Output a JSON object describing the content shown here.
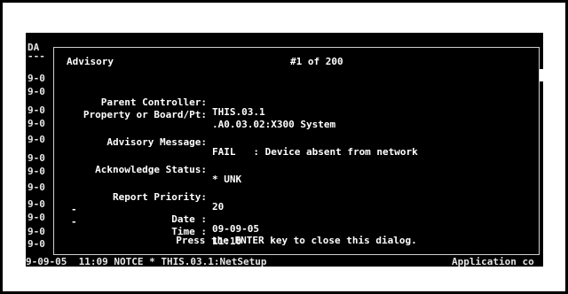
{
  "background": {
    "header_fragment": "DA",
    "row_prefix": "9-0",
    "rows_count": 12,
    "bottom_line_left": "9-09-05  11:09 NOTCE * THIS.03.1:NetSetup",
    "bottom_line_right": "Application co"
  },
  "dialog": {
    "title": "Advisory",
    "count": "#1 of 200",
    "fields": {
      "parent_controller": {
        "label": "Parent Controller:",
        "value": "THIS.03.1"
      },
      "property": {
        "label": "Property or Board/Pt:",
        "value": ".A0.03.02:X300 System"
      },
      "message": {
        "label": "Advisory Message:",
        "value": "FAIL   : Device absent from network"
      },
      "ack": {
        "label": "Acknowledge Status:",
        "value": "* UNK"
      },
      "priority": {
        "label": "Report Priority:",
        "value": "20"
      },
      "date": {
        "label": "Date :",
        "value": "09-09-05"
      },
      "time": {
        "label": "Time :",
        "value": "11:10"
      }
    },
    "dash": "-",
    "footer": "Press the ENTER key to close this dialog."
  },
  "colors": {
    "terminal_bg": "#000000",
    "text": "#ffffff",
    "frame": "#000000"
  }
}
